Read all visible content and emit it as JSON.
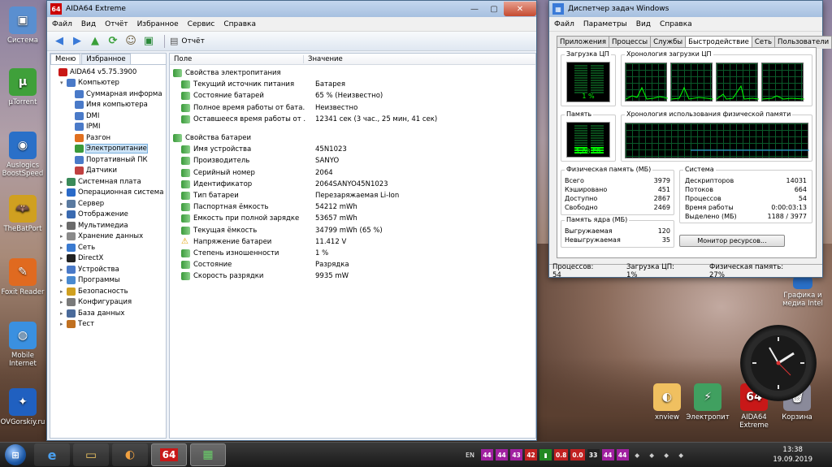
{
  "desktop": {
    "icons": [
      {
        "label": "Система",
        "color": "#5a8fd0",
        "glyph": "▣"
      },
      {
        "label": "µTorrent",
        "color": "#3fa03a",
        "glyph": "µ"
      },
      {
        "label": "Auslogics BoostSpeed",
        "color": "#2a70c8",
        "glyph": "◉"
      },
      {
        "label": "TheBatPort",
        "color": "#d0a020",
        "glyph": "🦇"
      },
      {
        "label": "Foxit Reader",
        "color": "#e06a20",
        "glyph": "✎"
      },
      {
        "label": "Mobile Internet",
        "color": "#3a90e0",
        "glyph": "◍"
      },
      {
        "label": "OVGorskiy.ru",
        "color": "#2060c0",
        "glyph": "✦"
      }
    ],
    "right_icons": [
      {
        "label": "xnview",
        "color": "#f0c060",
        "glyph": "◐"
      },
      {
        "label": "Электропит",
        "color": "#40a060",
        "glyph": "⚡"
      },
      {
        "label": "AIDA64 Extreme",
        "color": "#c81818",
        "glyph": "64"
      },
      {
        "label": "Корзина",
        "color": "#8a8a9a",
        "glyph": "🗑"
      }
    ],
    "intel_label": "Графика и медиа Intel"
  },
  "aida": {
    "title": "AIDA64 Extreme",
    "menu": [
      "Файл",
      "Вид",
      "Отчёт",
      "Избранное",
      "Сервис",
      "Справка"
    ],
    "report_label": "Отчёт",
    "tabs": [
      "Меню",
      "Избранное"
    ],
    "columns": [
      "Поле",
      "Значение"
    ],
    "tree": [
      {
        "label": "AIDA64 v5.75.3900",
        "level": 0,
        "exp": "",
        "color": "#c81818"
      },
      {
        "label": "Компьютер",
        "level": 1,
        "exp": "▾",
        "color": "#4a7ac8"
      },
      {
        "label": "Суммарная информа",
        "level": 2,
        "exp": "",
        "color": "#4a7ac8"
      },
      {
        "label": "Имя компьютера",
        "level": 2,
        "exp": "",
        "color": "#4a7ac8"
      },
      {
        "label": "DMI",
        "level": 2,
        "exp": "",
        "color": "#4a7ac8"
      },
      {
        "label": "IPMI",
        "level": 2,
        "exp": "",
        "color": "#4a7ac8"
      },
      {
        "label": "Разгон",
        "level": 2,
        "exp": "",
        "color": "#e07020"
      },
      {
        "label": "Электропитание",
        "level": 2,
        "exp": "",
        "color": "#3a9a3a",
        "selected": true
      },
      {
        "label": "Портативный ПК",
        "level": 2,
        "exp": "",
        "color": "#4a7ac8"
      },
      {
        "label": "Датчики",
        "level": 2,
        "exp": "",
        "color": "#c04040"
      },
      {
        "label": "Системная плата",
        "level": 1,
        "exp": "▸",
        "color": "#3a8a5a"
      },
      {
        "label": "Операционная система",
        "level": 1,
        "exp": "▸",
        "color": "#2a6ac8"
      },
      {
        "label": "Сервер",
        "level": 1,
        "exp": "▸",
        "color": "#5a7aa0"
      },
      {
        "label": "Отображение",
        "level": 1,
        "exp": "▸",
        "color": "#3a6ab0"
      },
      {
        "label": "Мультимедиа",
        "level": 1,
        "exp": "▸",
        "color": "#6a6a6a"
      },
      {
        "label": "Хранение данных",
        "level": 1,
        "exp": "▸",
        "color": "#8a8a8a"
      },
      {
        "label": "Сеть",
        "level": 1,
        "exp": "▸",
        "color": "#3a7ad0"
      },
      {
        "label": "DirectX",
        "level": 1,
        "exp": "▸",
        "color": "#222222"
      },
      {
        "label": "Устройства",
        "level": 1,
        "exp": "▸",
        "color": "#4a7ac8"
      },
      {
        "label": "Программы",
        "level": 1,
        "exp": "▸",
        "color": "#4a8ad0"
      },
      {
        "label": "Безопасность",
        "level": 1,
        "exp": "▸",
        "color": "#d0a020"
      },
      {
        "label": "Конфигурация",
        "level": 1,
        "exp": "▸",
        "color": "#7a7a7a"
      },
      {
        "label": "База данных",
        "level": 1,
        "exp": "▸",
        "color": "#4a6a9a"
      },
      {
        "label": "Тест",
        "level": 1,
        "exp": "▸",
        "color": "#c07020"
      }
    ],
    "sections": [
      {
        "title": "Свойства электропитания",
        "rows": [
          {
            "name": "Текущий источник питания",
            "value": "Батарея",
            "warn": false
          },
          {
            "name": "Состояние батарей",
            "value": "65 % (Неизвестно)",
            "warn": false
          },
          {
            "name": "Полное время работы от бата...",
            "value": "Неизвестно",
            "warn": false
          },
          {
            "name": "Оставшееся время работы от ...",
            "value": "12341 сек (3 час., 25 мин, 41 сек)",
            "warn": false
          }
        ]
      },
      {
        "title": "Свойства батареи",
        "rows": [
          {
            "name": "Имя устройства",
            "value": "45N1023",
            "warn": false
          },
          {
            "name": "Производитель",
            "value": "SANYO",
            "warn": false
          },
          {
            "name": "Серийный номер",
            "value": "2064",
            "warn": false
          },
          {
            "name": "Идентификатор",
            "value": "2064SANYO45N1023",
            "warn": false
          },
          {
            "name": "Тип батареи",
            "value": "Перезаряжаемая Li-Ion",
            "warn": false
          },
          {
            "name": "Паспортная ёмкость",
            "value": "54212 mWh",
            "warn": false
          },
          {
            "name": "Ёмкость при полной зарядке",
            "value": "53657 mWh",
            "warn": false
          },
          {
            "name": "Текущая ёмкость",
            "value": "34799 mWh  (65 %)",
            "warn": false
          },
          {
            "name": "Напряжение батареи",
            "value": "11.412 V",
            "warn": true
          },
          {
            "name": "Степень изношенности",
            "value": "1 %",
            "warn": false
          },
          {
            "name": "Состояние",
            "value": "Разрядка",
            "warn": false
          },
          {
            "name": "Скорость разрядки",
            "value": "9935 mW",
            "warn": false
          }
        ]
      }
    ]
  },
  "taskmgr": {
    "title": "Диспетчер задач Windows",
    "menu": [
      "Файл",
      "Параметры",
      "Вид",
      "Справка"
    ],
    "tabs": [
      "Приложения",
      "Процессы",
      "Службы",
      "Быстродействие",
      "Сеть",
      "Пользователи"
    ],
    "cpu_label": "Загрузка ЦП",
    "cpu_value": "1 %",
    "cpu_history_label": "Хронология загрузки ЦП",
    "mem_label": "Память",
    "mem_value": "1,08 ГБ",
    "mem_history_label": "Хронология использования физической памяти",
    "phys_title": "Физическая память (МБ)",
    "phys": [
      {
        "k": "Всего",
        "v": "3979"
      },
      {
        "k": "Кэшировано",
        "v": "451"
      },
      {
        "k": "Доступно",
        "v": "2867"
      },
      {
        "k": "Свободно",
        "v": "2469"
      }
    ],
    "kernel_title": "Память ядра (МБ)",
    "kernel": [
      {
        "k": "Выгружаемая",
        "v": "120"
      },
      {
        "k": "Невыгружаемая",
        "v": "35"
      }
    ],
    "sys_title": "Система",
    "sys": [
      {
        "k": "Дескрипторов",
        "v": "14031"
      },
      {
        "k": "Потоков",
        "v": "664"
      },
      {
        "k": "Процессов",
        "v": "54"
      },
      {
        "k": "Время работы",
        "v": "0:00:03:13"
      },
      {
        "k": "Выделено (МБ)",
        "v": "1188 / 3977"
      }
    ],
    "monitor_btn": "Монитор ресурсов...",
    "status": [
      "Процессов: 54",
      "Загрузка ЦП: 1%",
      "Физическая память: 27%"
    ]
  },
  "taskbar": {
    "lang": "EN",
    "tray_badges": [
      {
        "t": "44",
        "c": "#a020a0"
      },
      {
        "t": "44",
        "c": "#a020a0"
      },
      {
        "t": "43",
        "c": "#a020a0"
      },
      {
        "t": "42",
        "c": "#c02020"
      },
      {
        "t": "▮",
        "c": "#228822"
      },
      {
        "t": "0.8",
        "c": "#c02020"
      },
      {
        "t": "0.0",
        "c": "#c02020"
      },
      {
        "t": "33",
        "c": "#222222"
      },
      {
        "t": "44",
        "c": "#a020a0"
      },
      {
        "t": "44",
        "c": "#a020a0"
      }
    ],
    "time": "13:38",
    "date": "19.09.2019"
  }
}
